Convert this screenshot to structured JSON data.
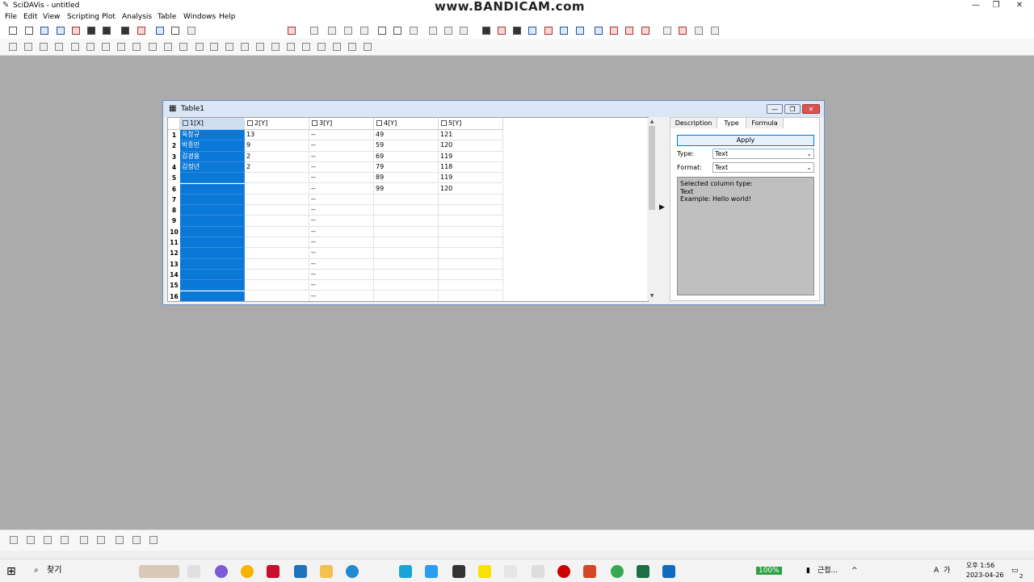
{
  "app": {
    "title": "SciDAVis - untitled",
    "watermark": "www.BANDICAM.com"
  },
  "menu": [
    "File",
    "Edit",
    "View",
    "Scripting",
    "Plot",
    "Analysis",
    "Table",
    "Windows",
    "Help"
  ],
  "table_window": {
    "title": "Table1",
    "columns": [
      "1[X]",
      "2[Y]",
      "3[Y]",
      "4[Y]",
      "5[Y]"
    ],
    "row_numbers": [
      "1",
      "2",
      "3",
      "4",
      "5",
      "6",
      "7",
      "8",
      "9",
      "10",
      "11",
      "12",
      "13",
      "14",
      "15",
      "16"
    ],
    "rows": [
      [
        "옥창규",
        "13",
        "--",
        "49",
        "121"
      ],
      [
        "박종민",
        "9",
        "--",
        "59",
        "120"
      ],
      [
        "김경용",
        "2",
        "--",
        "69",
        "119"
      ],
      [
        "김정년",
        "2",
        "--",
        "79",
        "118"
      ],
      [
        "",
        "",
        "--",
        "89",
        "119"
      ],
      [
        "",
        "",
        "--",
        "99",
        "120"
      ],
      [
        "",
        "",
        "--",
        "",
        ""
      ],
      [
        "",
        "",
        "--",
        "",
        ""
      ],
      [
        "",
        "",
        "--",
        "",
        ""
      ],
      [
        "",
        "",
        "--",
        "",
        ""
      ],
      [
        "",
        "",
        "--",
        "",
        ""
      ],
      [
        "",
        "",
        "--",
        "",
        ""
      ],
      [
        "",
        "",
        "--",
        "",
        ""
      ],
      [
        "",
        "",
        "--",
        "",
        ""
      ],
      [
        "",
        "",
        "--",
        "",
        ""
      ],
      [
        "",
        "",
        "--",
        "",
        ""
      ]
    ]
  },
  "panel": {
    "tabs": [
      "Description",
      "Type",
      "Formula"
    ],
    "active_tab": "Type",
    "apply_label": "Apply",
    "type_label": "Type:",
    "type_value": "Text",
    "format_label": "Format:",
    "format_value": "Text",
    "description_lines": [
      "Selected column type:",
      "Text",
      "Example: Hello world!"
    ]
  },
  "taskbar": {
    "search_placeholder": "찾기",
    "battery": "100%",
    "tray_text": "근접...",
    "time": "오후 1:56",
    "date": "2023-04-26",
    "notification_count": "2"
  },
  "colors": {
    "selection": "#0a78d7",
    "workspace": "#ababab"
  }
}
